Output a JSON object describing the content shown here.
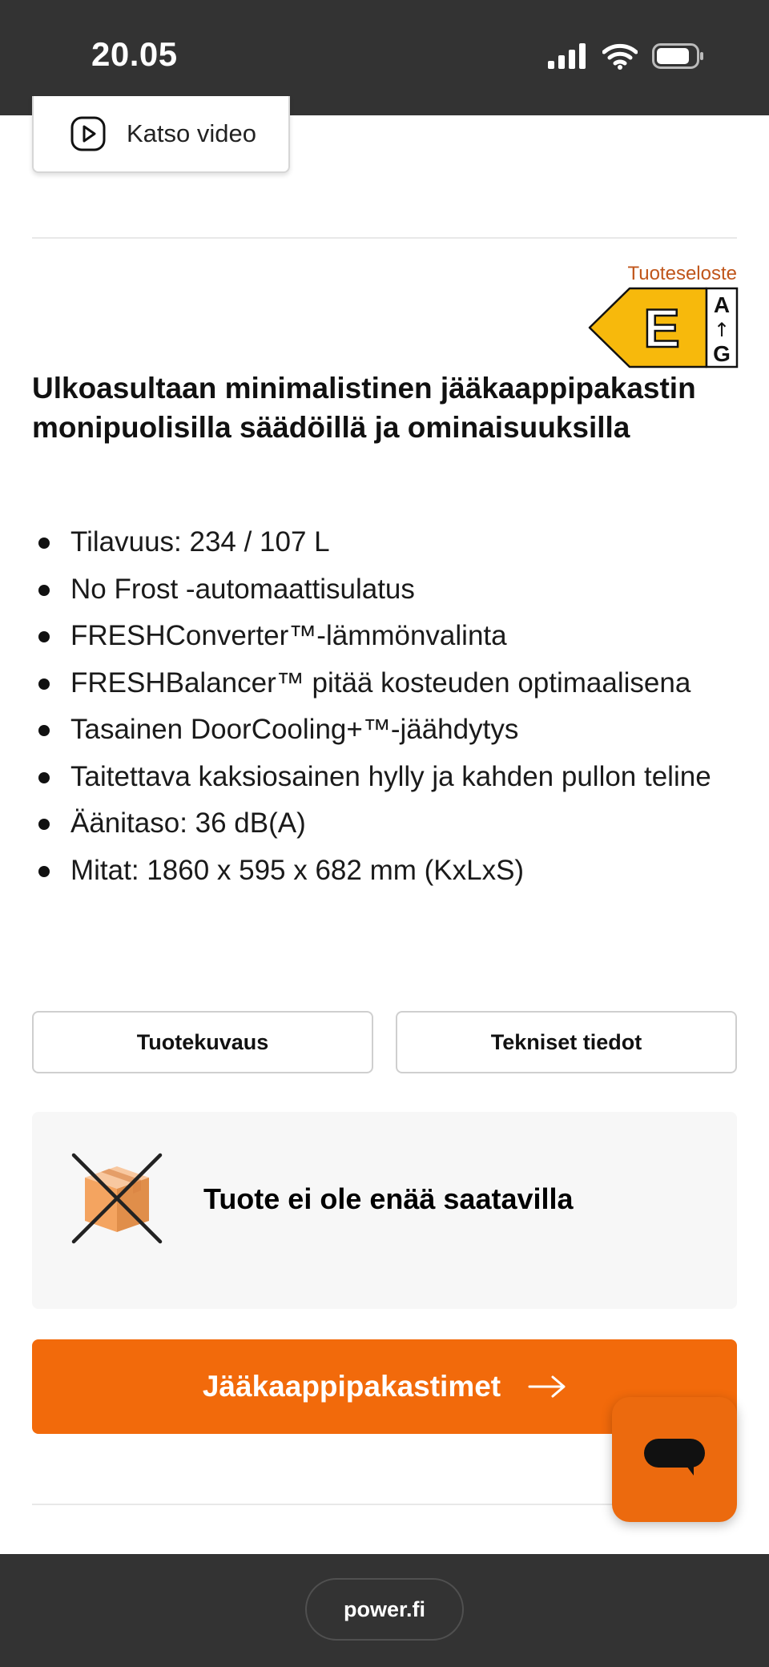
{
  "status_bar": {
    "time": "20.05",
    "icons": [
      "signal-icon",
      "wifi-icon",
      "battery-icon"
    ]
  },
  "video_button": {
    "label": "Katso video",
    "icon": "play-icon"
  },
  "energy": {
    "link_label": "Tuoteseloste",
    "class": "E",
    "scale_top": "A",
    "scale_arrow": "↑",
    "scale_bottom": "G",
    "color": "#f7b90c"
  },
  "product": {
    "headline": "Ulkoasultaan minimalistinen jääkaappipakastin monipuolisilla säädöillä ja ominaisuuksilla",
    "features": [
      "Tilavuus: 234 / 107 L",
      "No Frost -automaattisulatus",
      "FRESHConverter™-lämmönvalinta",
      "FRESHBalancer™ pitää kosteuden optimaalisena",
      "Tasainen DoorCooling+™-jäähdytys",
      "Taitettava kaksiosainen hylly ja kahden pullon teline",
      "Äänitaso: 36 dB(A)",
      "Mitat: 1860 x 595 x 682 mm (KxLxS)"
    ]
  },
  "tabs": {
    "description_label": "Tuotekuvaus",
    "specs_label": "Tekniset tiedot"
  },
  "availability": {
    "text": "Tuote ei ole enää saatavilla",
    "icon": "unavailable-box-icon"
  },
  "cta": {
    "label": "Jääkaappipakastimet",
    "icon": "arrow-right-icon",
    "color": "#f26a0b"
  },
  "chat": {
    "icon": "chat-icon"
  },
  "browser": {
    "url": "power.fi"
  }
}
